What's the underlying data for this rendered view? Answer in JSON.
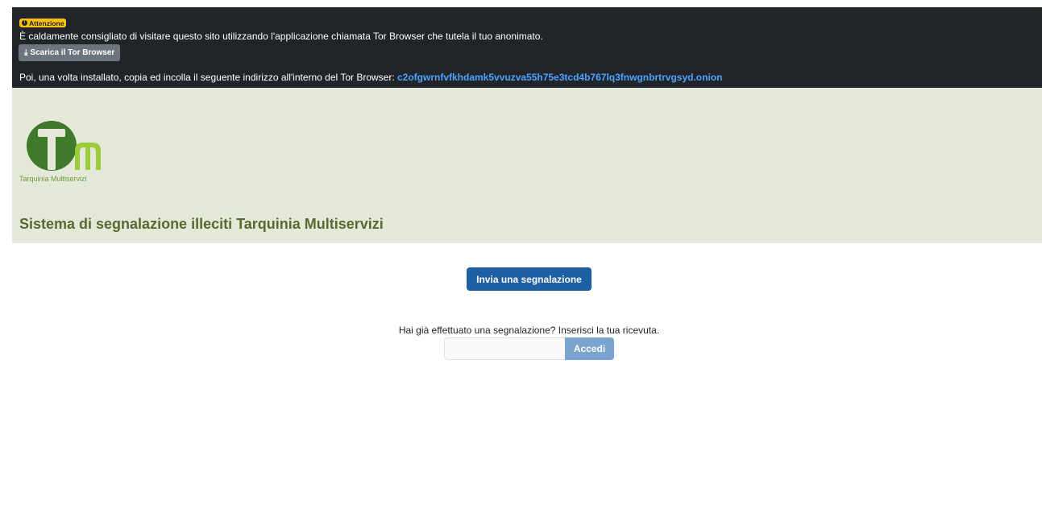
{
  "banner": {
    "badge_label": "Attenzione",
    "line1": "È caldamente consigliato di visitare questo sito utilizzando l'applicazione chiamata Tor Browser che tutela il tuo anonimato.",
    "download_button_label": "Scarica il Tor Browser",
    "line2_prefix": "Poi, una volta installato, copia ed incolla il seguente indirizzo all'interno del Tor Browser: ",
    "onion_address": "c2ofgwrnfvfkhdamk5vvuzva55h75e3tcd4b767lq3fnwgnbrtrvgsyd.onion",
    "icons": {
      "badge_icon": "info-circle-icon",
      "download_icon": "download-icon"
    }
  },
  "header": {
    "logo_text": "Tarquinia Multiservizi",
    "title": "Sistema di segnalazione illeciti Tarquinia Multiservizi"
  },
  "main": {
    "submit_button_label": "Invia una segnalazione",
    "receipt_prompt": "Hai già effettuato una segnalazione? Inserisci la tua ricevuta.",
    "receipt_input_value": "",
    "login_button_label": "Accedi"
  },
  "colors": {
    "banner_bg": "#212529",
    "badge_bg": "#ffc107",
    "header_bg": "#e4e8d8",
    "title_color": "#556b2f",
    "primary_button": "#1f5fa6",
    "login_button": "#7aa3d2",
    "logo_dark_green": "#3f7a2a",
    "logo_light_green": "#9ccc3c"
  }
}
